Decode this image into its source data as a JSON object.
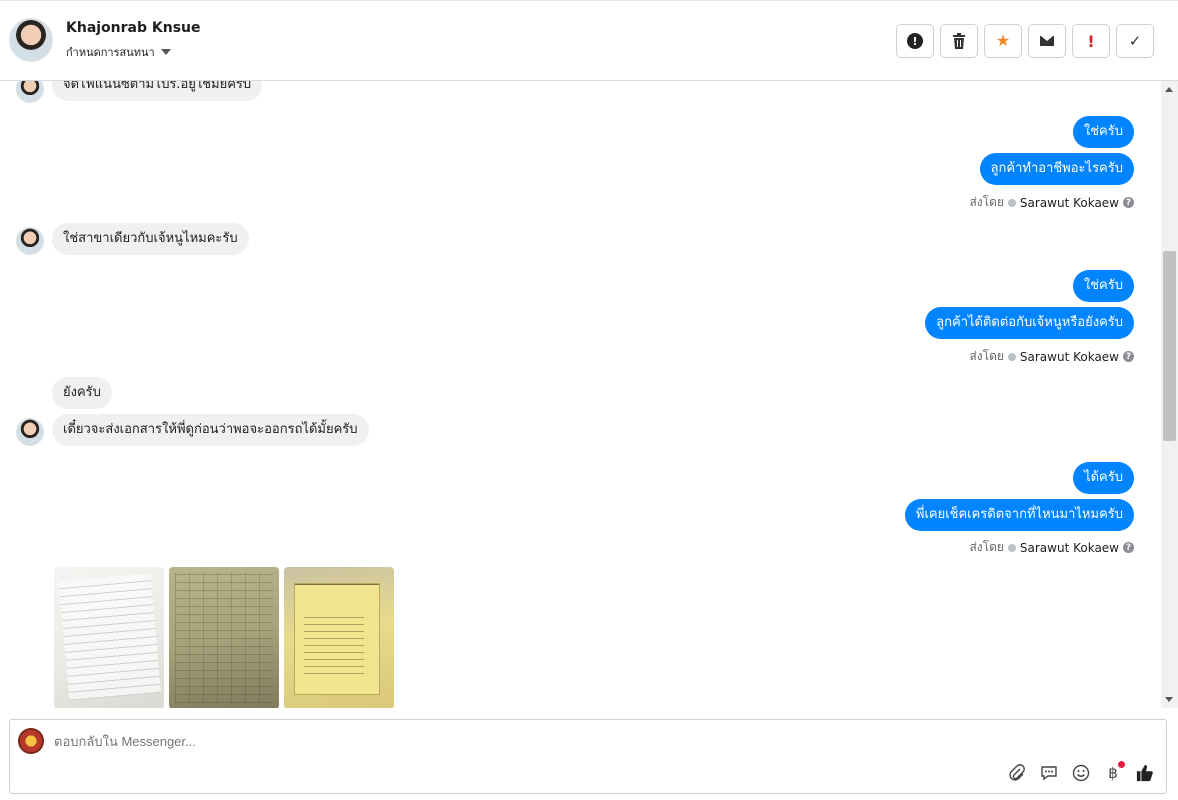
{
  "header": {
    "name": "Khajonrab Knsue",
    "subtitle": "กำหนดการสนทนา"
  },
  "actions": [
    {
      "name": "report-icon"
    },
    {
      "name": "trash-icon"
    },
    {
      "name": "star-icon"
    },
    {
      "name": "mail-icon"
    },
    {
      "name": "important-icon"
    },
    {
      "name": "check-icon"
    }
  ],
  "messages": {
    "m0": "จัดไฟแนนซ์ตามโปร.อยู่ใช่มั้ยครับ",
    "m1": "ใช่ครับ",
    "m2": "ลูกค้าทำอาชีพอะไรครับ",
    "m3": "ใช่สาขาเดียวกับเจ้หนูไหมคะรับ",
    "m4": "ใช่ครับ",
    "m5": "ลูกค้าได้ติดต่อกับเจ้หนูหรือยังครับ",
    "m6": "ยังครับ",
    "m7": "เดี๋ยวจะส่งเอกสารให้พี่ดูก่อนว่าพอจะออกรถได้มั้ยครับ",
    "m8": "ได้ครับ",
    "m9": "พี่เคยเช็คเครดิตจากที่ไหนมาไหมครับ"
  },
  "meta": {
    "sent_by": "ส่งโดย",
    "agent": "Sarawut Kokaew"
  },
  "composer": {
    "placeholder": "ตอบกลับใน Messenger..."
  },
  "tools": [
    {
      "name": "attach-icon"
    },
    {
      "name": "saved-reply-icon"
    },
    {
      "name": "emoji-icon"
    },
    {
      "name": "payment-icon",
      "label": "฿"
    },
    {
      "name": "like-icon"
    }
  ]
}
